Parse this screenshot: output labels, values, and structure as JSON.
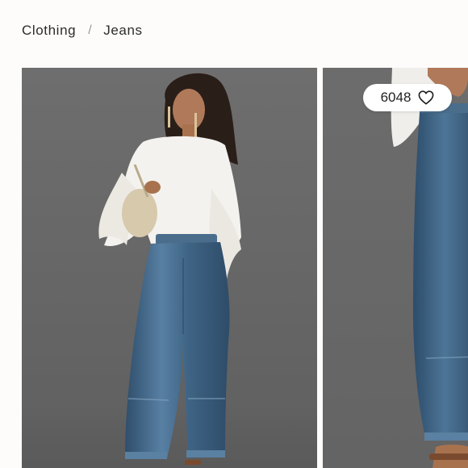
{
  "breadcrumb": {
    "items": [
      {
        "label": "Clothing"
      },
      {
        "label": "Jeans"
      }
    ],
    "separator": "/"
  },
  "gallery": {
    "images": [
      {
        "alt": "",
        "icon": "model-photo-front"
      },
      {
        "alt": "",
        "icon": "model-photo-side-crop"
      }
    ]
  },
  "likes": {
    "count": "6048",
    "icon": "heart-outline-icon"
  },
  "colors": {
    "background": "#fdfcfb",
    "text": "#2c2c2c",
    "photo_backdrop": "#686868",
    "denim": "#3f6485",
    "blouse": "#f4f2ee"
  }
}
